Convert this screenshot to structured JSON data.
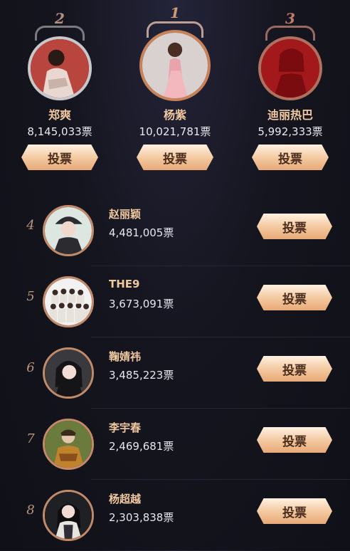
{
  "podium": [
    {
      "rank": "2",
      "name": "郑爽",
      "votes": "8,145,033票",
      "button": "投票",
      "colors": {
        "bg": "#b8463e",
        "figure": "#e9d8d0"
      }
    },
    {
      "rank": "1",
      "name": "杨紫",
      "votes": "10,021,781票",
      "button": "投票",
      "colors": {
        "bg": "#d9d1cf",
        "figure": "#e8a4aa"
      }
    },
    {
      "rank": "3",
      "name": "迪丽热巴",
      "votes": "5,992,333票",
      "button": "投票",
      "colors": {
        "bg": "#a3191b",
        "figure": "#7a0c10"
      }
    }
  ],
  "list": [
    {
      "rank": "4",
      "name": "赵丽颖",
      "votes": "4,481,005票",
      "button": "投票",
      "colors": {
        "bg": "#dde6e0",
        "figure": "#2b2b30"
      }
    },
    {
      "rank": "5",
      "name": "THE9",
      "votes": "3,673,091票",
      "button": "投票",
      "colors": {
        "bg": "#f2f2f2",
        "figure": "#e8e2dc"
      }
    },
    {
      "rank": "6",
      "name": "鞠婧祎",
      "votes": "3,485,223票",
      "button": "投票",
      "colors": {
        "bg": "#3a3a3e",
        "figure": "#151518"
      }
    },
    {
      "rank": "7",
      "name": "李宇春",
      "votes": "2,469,681票",
      "button": "投票",
      "colors": {
        "bg": "#6b7b3e",
        "figure": "#c0832c"
      }
    },
    {
      "rank": "8",
      "name": "杨超越",
      "votes": "2,303,838票",
      "button": "投票",
      "colors": {
        "bg": "#1e2024",
        "figure": "#e8e4e0"
      }
    }
  ],
  "accent_color": "#f0c8a0",
  "button_gradient": [
    "#fff1e2",
    "#e7a978"
  ]
}
